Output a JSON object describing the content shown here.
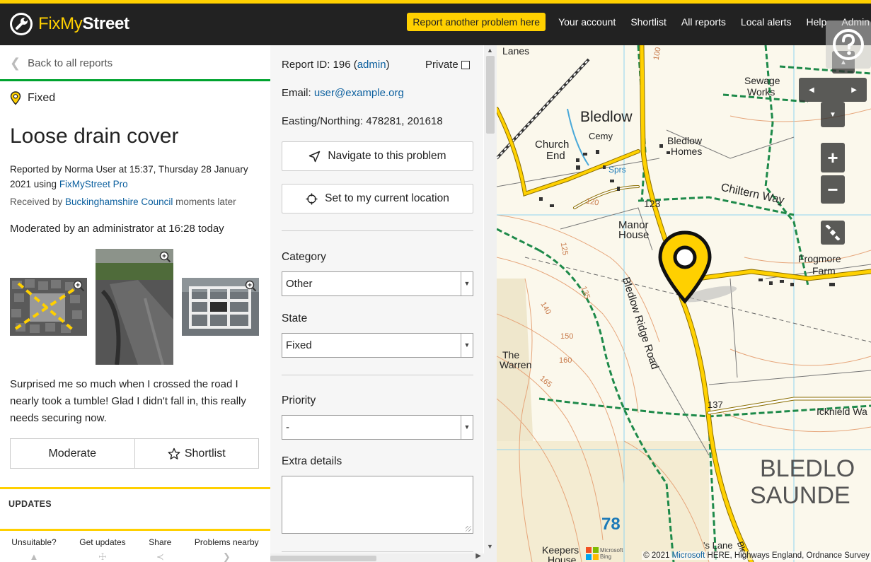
{
  "header": {
    "logo_fix": "FixMy",
    "logo_street": "Street",
    "nav": {
      "report": "Report another problem here",
      "account": "Your account",
      "shortlist": "Shortlist",
      "all_reports": "All reports",
      "local_alerts": "Local alerts",
      "help": "Help",
      "admin": "Admin"
    }
  },
  "report": {
    "back": "Back to all reports",
    "status": "Fixed",
    "title": "Loose drain cover",
    "reported_prefix": "Reported by Norma User at 15:37, Thursday 28 January 2021 using ",
    "reported_via": "FixMyStreet Pro",
    "received_prefix": "Received by ",
    "received_body": "Buckinghamshire Council",
    "received_suffix": " moments later",
    "moderated": "Moderated by an administrator at 16:28 today",
    "description": "Surprised me so much when I crossed the road I nearly took a tumble! Glad I didn't fall in, this really needs securing now.",
    "moderate": "Moderate",
    "shortlist": "Shortlist",
    "updates": "UPDATES",
    "footer": {
      "unsuitable": "Unsuitable?",
      "get_updates": "Get updates",
      "share": "Share",
      "nearby": "Problems nearby"
    }
  },
  "admin": {
    "report_id_label": "Report ID: 196 (",
    "report_id_link": "admin",
    "report_id_close": ")",
    "private": "Private",
    "email_label": "Email: ",
    "email": "user@example.org",
    "easting": "Easting/Northing: 478281, 201618",
    "navigate": "Navigate to this problem",
    "set_location": "Set to my current location",
    "category_label": "Category",
    "category": "Other",
    "state_label": "State",
    "state": "Fixed",
    "priority_label": "Priority",
    "priority": "-",
    "extra_label": "Extra details"
  },
  "map": {
    "labels": {
      "lanes": "Lanes",
      "sewage": "Sewage",
      "works": "Works",
      "bledlow": "Bledlow",
      "cemy": "Cemy",
      "church": "Church",
      "end": "End",
      "bledlow_homes_1": "Bledlow",
      "bledlow_homes_2": "Homes",
      "sprs": "Sprs",
      "chiltern_way": "Chiltern Way",
      "n123": "123",
      "manor": "Manor",
      "house": "House",
      "road": "Bledlow Ridge Road",
      "frogmore": "Frogmore",
      "farm": "Farm",
      "the": "The",
      "warren": "Warren",
      "n137": "137",
      "icknield": "Icknield Wa",
      "bledlo": "BLEDLO",
      "saunde": "SAUNDE",
      "n78": "78",
      "keepers": "Keepers",
      "keepers_house": "House",
      "lane": "'s Lane",
      "n125": "125",
      "n135": "135",
      "n140": "140",
      "n150": "150",
      "n160": "160",
      "n165": "165",
      "n120": "120",
      "n100": "100",
      "bled_road": "Bled"
    },
    "attribution_prefix": "© 2021 ",
    "attribution_link": "Microsoft",
    "attribution_suffix": " HERE, Highways England, Ordnance Survey",
    "bing_1": "Microsoft",
    "bing_2": "Bing"
  },
  "colors": {
    "accent_yellow": "#ffd000",
    "header_bg": "#222222",
    "status_green": "#00a32f",
    "link_blue": "#0b5f9e"
  }
}
